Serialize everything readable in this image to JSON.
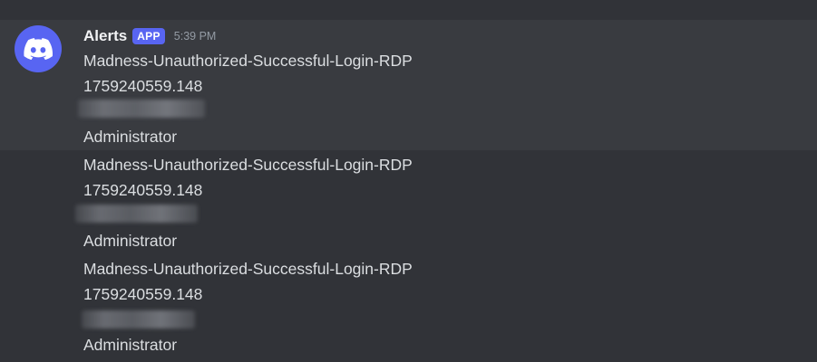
{
  "message": {
    "author": "Alerts",
    "badge": "APP",
    "timestamp": "5:39 PM",
    "avatar_icon": "discord-logo-icon",
    "avatar_color": "#5865f2"
  },
  "entries": [
    {
      "alert_name": "Madness-Unauthorized-Successful-Login-RDP",
      "event_id": "1759240559.148",
      "user": "Administrator"
    },
    {
      "alert_name": "Madness-Unauthorized-Successful-Login-RDP",
      "event_id": "1759240559.148",
      "user": "Administrator"
    },
    {
      "alert_name": "Madness-Unauthorized-Successful-Login-RDP",
      "event_id": "1759240559.148",
      "user": "Administrator"
    }
  ],
  "colors": {
    "background": "#313338",
    "hover_background": "#393b40",
    "accent": "#5865f2",
    "text": "#dbdee1",
    "muted": "#949ba4"
  }
}
